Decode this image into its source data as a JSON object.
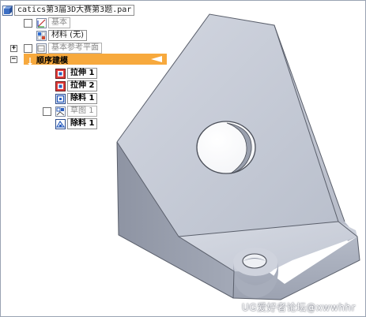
{
  "tree": {
    "root_file": "catics第3届3D大赛第3题.par",
    "base_label": "基本",
    "material_label": "材料 (无)",
    "base_ref_planes_label": "基本参考平面",
    "ordered_modeling_label": "顺序建模",
    "features": [
      {
        "name": "拉伸",
        "index": "1",
        "icon": "extrude-icon"
      },
      {
        "name": "拉伸",
        "index": "2",
        "icon": "extrude-icon"
      },
      {
        "name": "除料",
        "index": "1",
        "icon": "cutout-icon"
      }
    ],
    "sketch": {
      "name": "草图",
      "index": "1",
      "icon": "sketch-icon"
    },
    "last_feature": {
      "name": "除料",
      "index": "1",
      "icon": "cutout-icon"
    }
  },
  "watermark": "UG爱好者论坛@xwwhhr",
  "colors": {
    "background": "#ffffff",
    "part_face_light": "#c6cbd8",
    "part_face_dark": "#8d93a2",
    "highlight": "#f7a93d"
  }
}
